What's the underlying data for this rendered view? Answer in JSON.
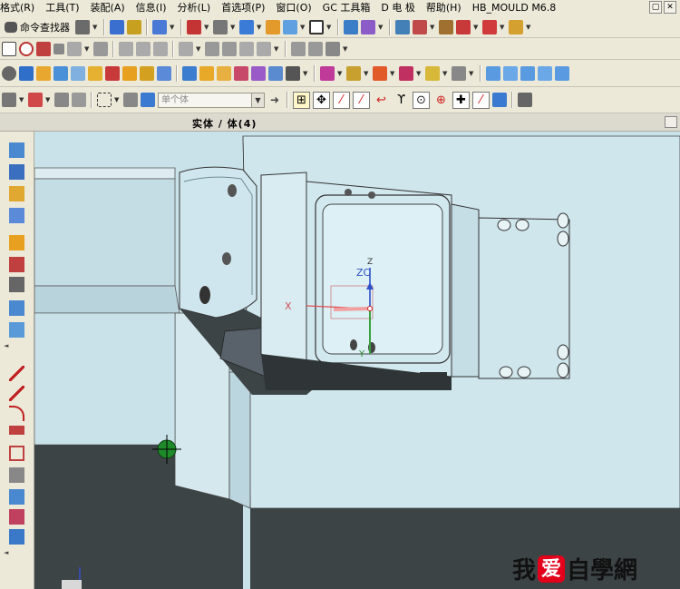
{
  "menubar": {
    "items": [
      "格式(R)",
      "工具(T)",
      "装配(A)",
      "信息(I)",
      "分析(L)",
      "首选项(P)",
      "窗口(O)",
      "GC 工具箱",
      "D 电  极",
      "帮助(H)",
      "HB_MOULD M6.8"
    ]
  },
  "toolbar": {
    "command_finder": "命令查找器",
    "select_filter": {
      "value": "单个体",
      "placeholder": "单个体"
    }
  },
  "viewport": {
    "title": "实体 / 体(4)",
    "axis_labels": {
      "x": "X",
      "zc": "ZC",
      "z": "Z",
      "y": "Y"
    }
  },
  "watermark": {
    "text_before": "我",
    "heart_char": "爱",
    "text_after": "自學網"
  },
  "colors": {
    "viewport_bg": "#c9e1e8",
    "model_fill": "#cde6ee",
    "dark_shade": "#3d4446",
    "accent_red": "#e2001a"
  }
}
